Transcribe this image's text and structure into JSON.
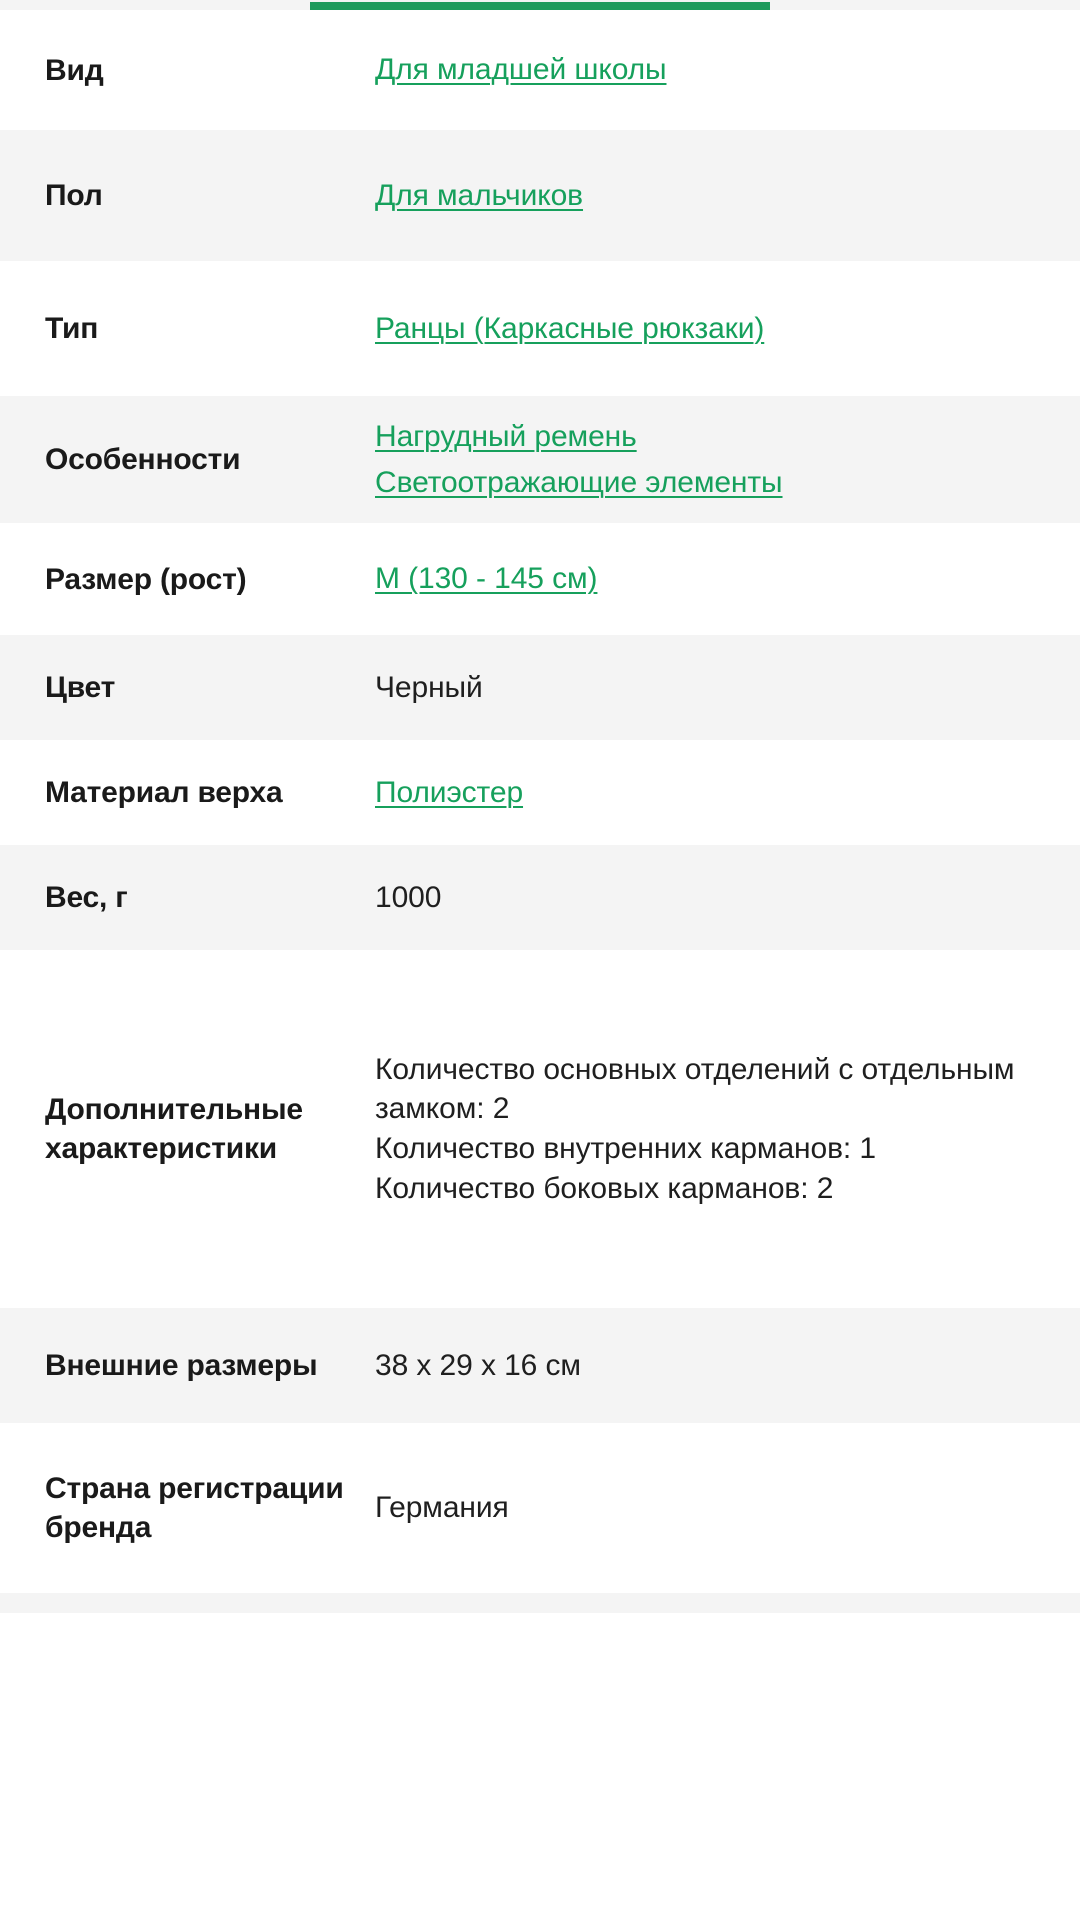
{
  "theme": {
    "link_green": "#16a05c",
    "accent_green": "#1f9a5c",
    "row_alt_bg": "#f4f4f4",
    "row_bg": "#ffffff",
    "text_dark": "#1a1a1a"
  },
  "spec_table": {
    "rows": [
      {
        "label": "Вид",
        "type": "link",
        "values": [
          "Для младшей школы"
        ]
      },
      {
        "label": "Пол",
        "type": "link",
        "values": [
          "Для мальчиков"
        ]
      },
      {
        "label": "Тип",
        "type": "link",
        "values": [
          "Ранцы (Каркасные рюкзаки)"
        ]
      },
      {
        "label": "Особенности",
        "type": "link",
        "values": [
          "Нагрудный ремень",
          "Светоотражающие элементы"
        ]
      },
      {
        "label": "Размер (рост)",
        "type": "link",
        "values": [
          "M (130 - 145 см)"
        ]
      },
      {
        "label": "Цвет",
        "type": "plain",
        "values": [
          "Черный"
        ]
      },
      {
        "label": "Материал верха",
        "type": "link",
        "values": [
          "Полиэстер"
        ]
      },
      {
        "label": "Вес, г",
        "type": "plain",
        "values": [
          "1000"
        ]
      },
      {
        "label": "Дополнительные характеристики",
        "type": "plain",
        "values": [
          "Количество основных отделений с отдельным замком: 2\nКоличество внутренних карманов: 1\nКоличество боковых карманов: 2"
        ]
      },
      {
        "label": "Внешние размеры",
        "type": "plain",
        "values": [
          "38 x 29 x 16 см"
        ]
      },
      {
        "label": "Страна регистрации бренда",
        "type": "plain",
        "values": [
          "Германия"
        ]
      }
    ]
  }
}
